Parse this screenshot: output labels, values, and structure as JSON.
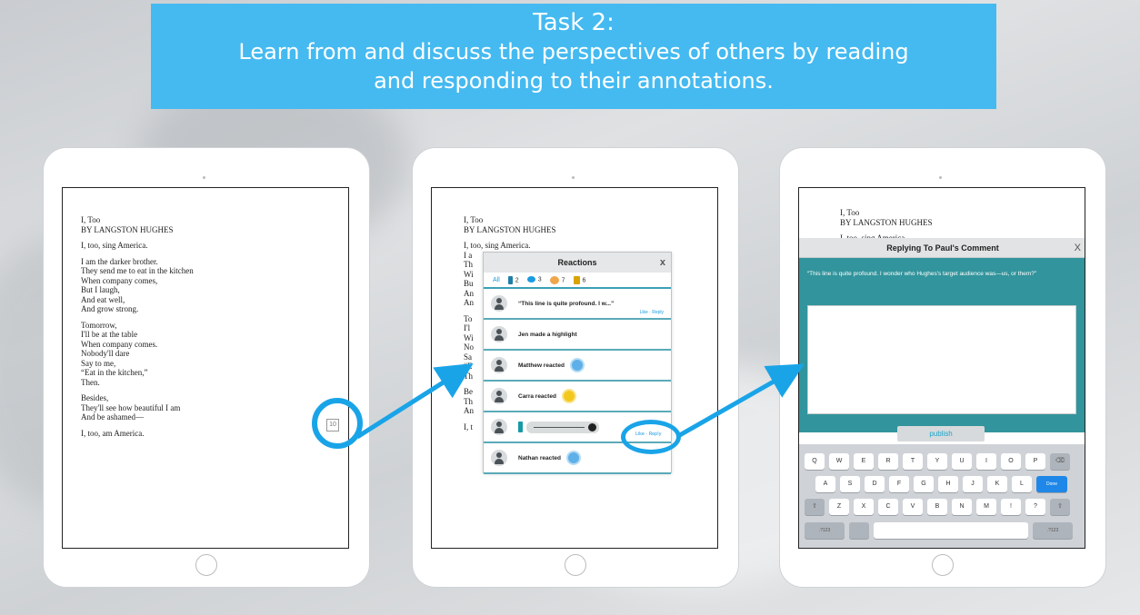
{
  "banner": {
    "line1": "Task 2:",
    "line2": "Learn from and discuss the perspectives of others by reading",
    "line3": "and responding to their annotations."
  },
  "poem": {
    "title": "I, Too",
    "author": "BY LANGSTON HUGHES",
    "stanzas": [
      [
        "I, too, sing America."
      ],
      [
        "I am the darker brother.",
        "They send me to eat in the kitchen",
        "When company comes,",
        "But I laugh,",
        "And eat well,",
        "And grow strong."
      ],
      [
        "Tomorrow,",
        "I'll be at the table",
        "When company comes.",
        "Nobody'll dare",
        "Say to me,",
        "“Eat in the kitchen,”",
        "Then."
      ],
      [
        "Besides,",
        "They'll see how beautiful I am",
        "And be ashamed—"
      ],
      [
        "I, too, am America."
      ]
    ],
    "annotation_count": "10"
  },
  "tablet2": {
    "title": "I, Too",
    "author": "BY LANGSTON HUGHES",
    "line1": "I, too, sing America.",
    "left_fragments": [
      "I a",
      "Th",
      "Wi",
      "Bu",
      "An",
      "An",
      "",
      "To",
      "I'l",
      "Wi",
      "No",
      "Sa",
      "“E",
      "Th",
      "",
      "Be",
      "Th",
      "An",
      "",
      "I, t"
    ]
  },
  "reactions": {
    "title": "Reactions",
    "close": "x",
    "filters": {
      "all": "All",
      "highlights": "2",
      "comments": "3",
      "reactions": "7",
      "edits": "6"
    },
    "items": [
      {
        "text": "“This line is quite profound. I w...”",
        "actions": "Like · Reply"
      },
      {
        "text": "Jen made a highlight"
      },
      {
        "text": "Matthew reacted"
      },
      {
        "text": "Carra reacted"
      },
      {
        "text": ""
      },
      {
        "text": "Nathan reacted"
      }
    ],
    "audio_actions": "Like · Reply"
  },
  "reply": {
    "title_text": "I, Too",
    "author": "BY LANGSTON HUGHES",
    "line1": "I, too, sing America.",
    "header": "Replying To Paul's Comment",
    "close": "X",
    "quote": "“This line is quite profound. I wonder who Hughes's target audience was—us, or them?”",
    "publish": "publish",
    "keys_row1": [
      "Q",
      "W",
      "E",
      "R",
      "T",
      "Y",
      "U",
      "I",
      "O",
      "P",
      "⌫"
    ],
    "keys_row2": [
      "A",
      "S",
      "D",
      "F",
      "G",
      "H",
      "J",
      "K",
      "L",
      "Done"
    ],
    "keys_row3": [
      "⇧",
      "Z",
      "X",
      "C",
      "V",
      "B",
      "N",
      "M",
      "!",
      "?",
      "⇧"
    ],
    "keys_row4": [
      ".?123",
      "",
      "",
      ".?123"
    ]
  },
  "colors": {
    "banner": "#45baf0",
    "arrow": "#1aa4e8",
    "teal": "#32949c"
  }
}
